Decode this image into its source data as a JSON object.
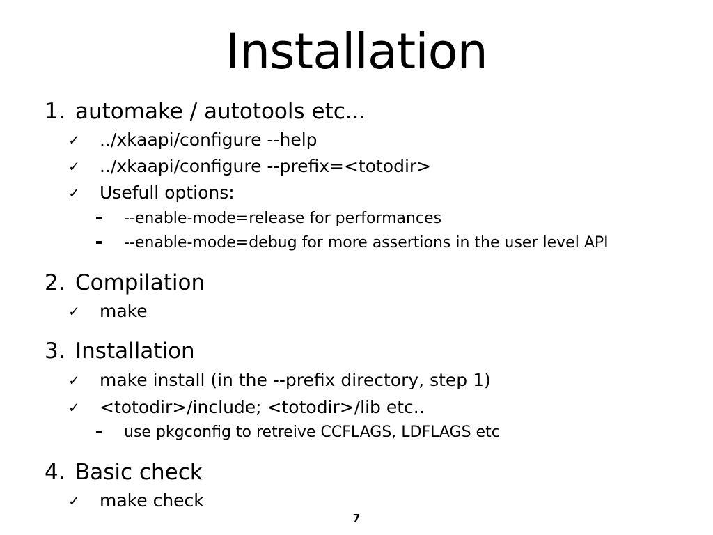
{
  "slide": {
    "title": "Installation",
    "page_number": "7",
    "sections": [
      {
        "number": "1.",
        "heading": "automake / autotools etc...",
        "items": [
          {
            "text": "../xkaapi/configure --help",
            "subitems": []
          },
          {
            "text": "../xkaapi/configure --prefix=<totodir>",
            "subitems": []
          },
          {
            "text": "Usefull options:",
            "subitems": [
              "--enable-mode=release for performances",
              "--enable-mode=debug for more assertions in the user level API"
            ]
          }
        ]
      },
      {
        "number": "2.",
        "heading": "Compilation",
        "items": [
          {
            "text": "make",
            "subitems": []
          }
        ]
      },
      {
        "number": "3.",
        "heading": "Installation",
        "items": [
          {
            "text": "make install (in the --prefix directory, step 1)",
            "subitems": []
          },
          {
            "text": "<totodir>/include; <totodir>/lib etc..",
            "subitems": [
              "use pkgconfig to retreive CCFLAGS, LDFLAGS etc"
            ]
          }
        ]
      },
      {
        "number": "4.",
        "heading": "Basic check",
        "items": [
          {
            "text": "make check",
            "subitems": []
          }
        ]
      }
    ]
  },
  "icons": {
    "check_bullet": "checkmark-icon",
    "dash_bullet": "dash-bullet-icon"
  },
  "colors": {
    "background": "#ffffff",
    "text": "#000000"
  }
}
